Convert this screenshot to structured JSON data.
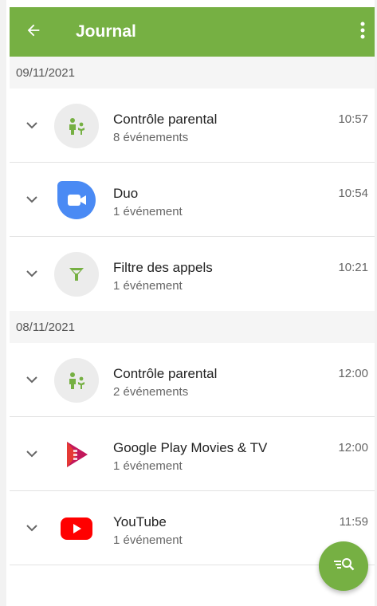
{
  "appbar": {
    "title": "Journal",
    "back_icon": "arrow-left-icon",
    "more_icon": "more-vert-icon"
  },
  "groups": [
    {
      "date": "09/11/2021",
      "items": [
        {
          "name": "Contrôle parental",
          "count": "8 événements",
          "time": "10:57",
          "icon": "family-icon"
        },
        {
          "name": "Duo",
          "count": "1 événement",
          "time": "10:54",
          "icon": "duo-icon"
        },
        {
          "name": "Filtre des appels",
          "count": "1 événement",
          "time": "10:21",
          "icon": "filter-icon"
        }
      ]
    },
    {
      "date": "08/11/2021",
      "items": [
        {
          "name": "Contrôle parental",
          "count": "2 événements",
          "time": "12:00",
          "icon": "family-icon"
        },
        {
          "name": "Google Play Movies & TV",
          "count": "1 événement",
          "time": "12:00",
          "icon": "play-movies-icon"
        },
        {
          "name": "YouTube",
          "count": "1 événement",
          "time": "11:59",
          "icon": "youtube-icon"
        }
      ]
    }
  ],
  "fab": {
    "icon": "filter-search-icon"
  },
  "colors": {
    "accent": "#76b043",
    "duo": "#4a8af4",
    "youtube": "#ff0000",
    "movies": "#c2185b"
  }
}
